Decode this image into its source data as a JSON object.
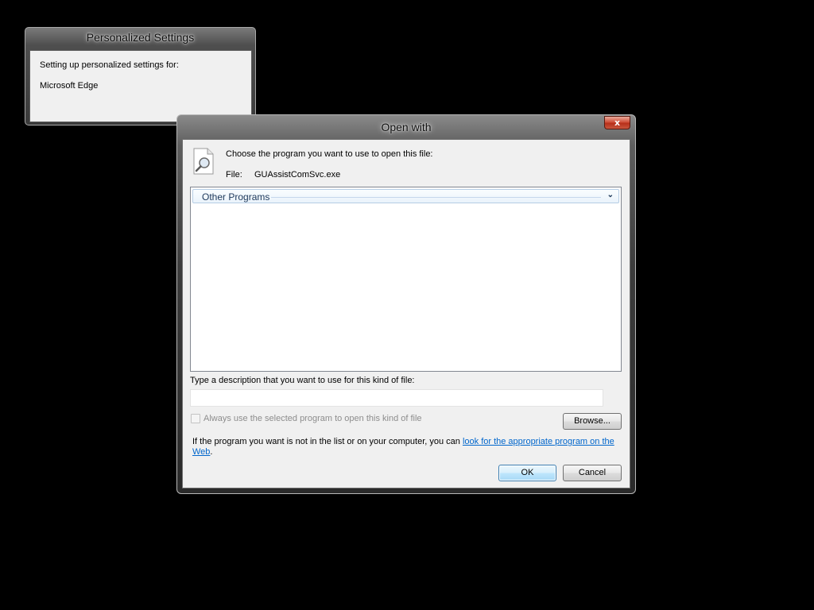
{
  "personalized_settings": {
    "title": "Personalized Settings",
    "message": "Setting up personalized settings for:",
    "app_name": "Microsoft Edge"
  },
  "open_with": {
    "title": "Open with",
    "close_glyph": "x",
    "prompt": "Choose the program you want to use to open this file:",
    "file_label": "File:",
    "file_name": "GUAssistComSvc.exe",
    "program_group": {
      "label": "Other Programs",
      "expanded": true,
      "icon": "chevron-down-icon"
    },
    "description_label": "Type a description that you want to use for this kind of file:",
    "description_value": "",
    "always_use": {
      "label": "Always use the selected program to open this kind of file",
      "checked": false,
      "enabled": false
    },
    "browse_label": "Browse...",
    "info_text_prefix": "If the program you want is not in the list or on your computer, you can ",
    "info_link": "look for the appropriate program on the Web",
    "info_text_suffix": ".",
    "ok_label": "OK",
    "cancel_label": "Cancel"
  },
  "colors": {
    "desktop": "#000000",
    "dialog_face": "#f0f0f0",
    "link": "#0066cc",
    "group_header_text": "#1e395b",
    "close_button": "#c8553c"
  }
}
